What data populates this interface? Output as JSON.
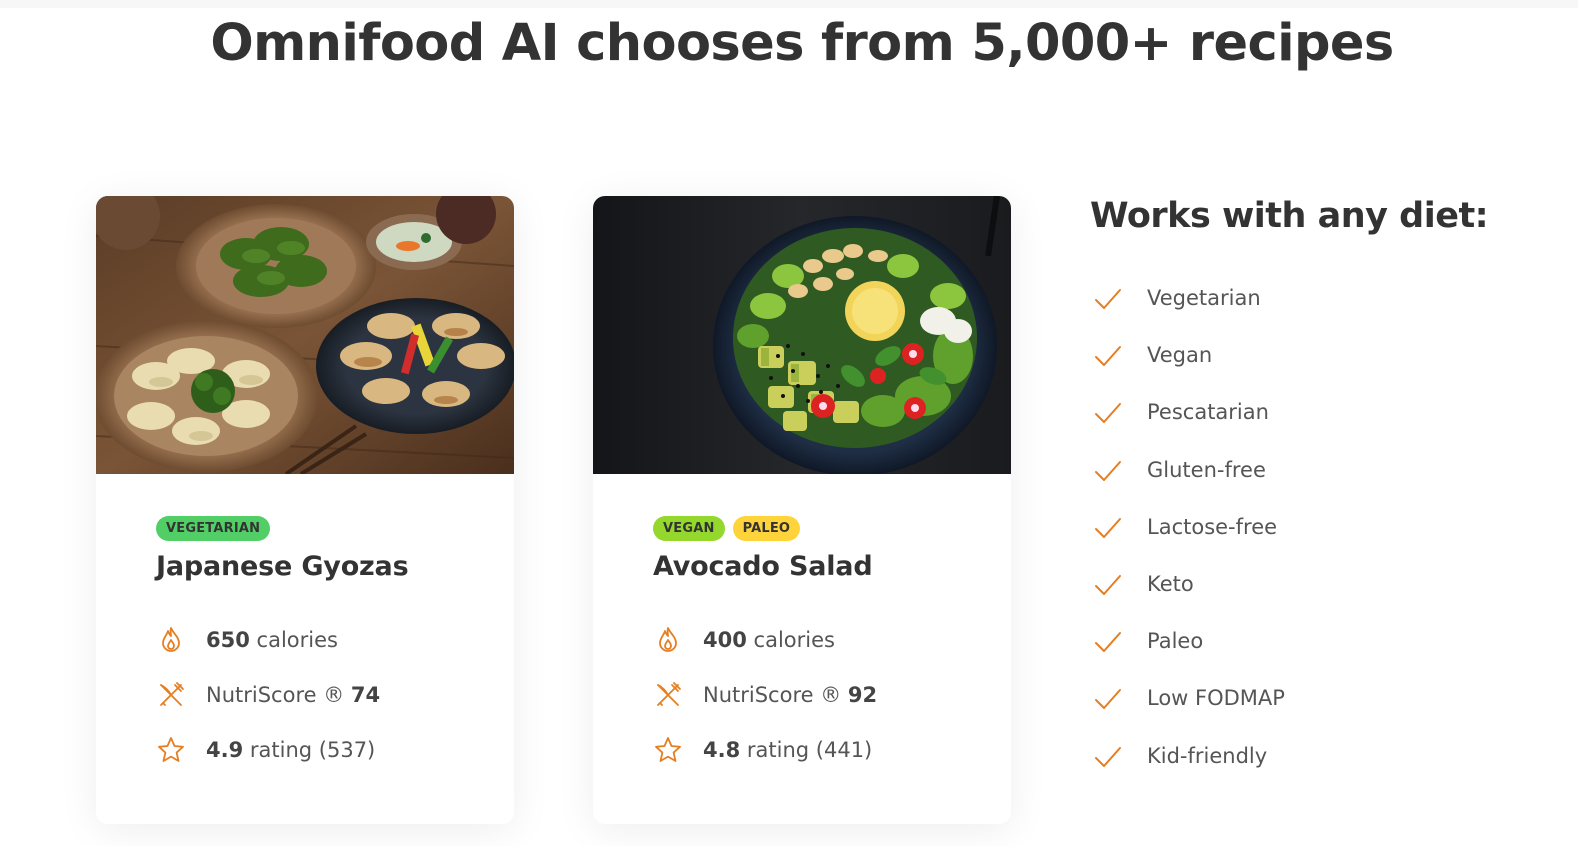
{
  "heading": "Omnifood AI chooses from 5,000+ recipes",
  "cards": [
    {
      "image_alt": "Japanese Gyozas",
      "tags": [
        "VEGETARIAN"
      ],
      "title": "Japanese Gyozas",
      "calories_value": "650",
      "calories_label": "calories",
      "nutriscore_label": "NutriScore ®",
      "nutriscore_value": "74",
      "rating_value": "4.9",
      "rating_label": "rating (537)"
    },
    {
      "image_alt": "Avocado Salad",
      "tags": [
        "VEGAN",
        "PALEO"
      ],
      "title": "Avocado Salad",
      "calories_value": "400",
      "calories_label": "calories",
      "nutriscore_label": "NutriScore ®",
      "nutriscore_value": "92",
      "rating_value": "4.8",
      "rating_label": "rating (441)"
    }
  ],
  "diets": {
    "title": "Works with any diet:",
    "items": [
      "Vegetarian",
      "Vegan",
      "Pescatarian",
      "Gluten-free",
      "Lactose-free",
      "Keto",
      "Paleo",
      "Low FODMAP",
      "Kid-friendly"
    ]
  },
  "icons": {
    "calories": "flame-icon",
    "nutriscore": "fork-knife-icon",
    "rating": "star-icon",
    "diet_item": "checkmark-icon"
  },
  "colors": {
    "accent": "#e67e22",
    "tag_vegetarian": "#51cf66",
    "tag_vegan": "#94d82d",
    "tag_paleo": "#ffd43b",
    "text_dark": "#333333"
  }
}
